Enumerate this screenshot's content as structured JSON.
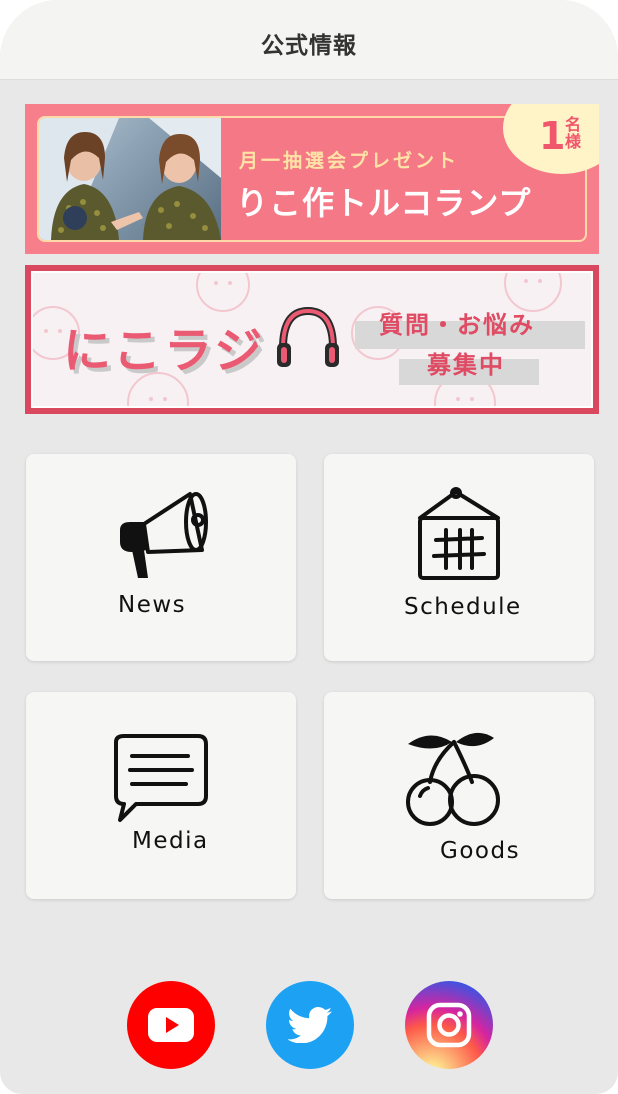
{
  "header": {
    "title": "公式情報"
  },
  "banner_present": {
    "subtitle": "月一抽選会プレゼント",
    "title": "りこ作トルコランプ",
    "badge_number": "1",
    "badge_unit": "名様"
  },
  "banner_radio": {
    "brand": "にこラジ",
    "message_line1": "質問・お悩み",
    "message_line2": "募集中"
  },
  "menu": {
    "news": "News",
    "schedule": "Schedule",
    "media": "Media",
    "goods": "Goods"
  },
  "social": {
    "youtube": "youtube-icon",
    "twitter": "twitter-icon",
    "instagram": "instagram-icon"
  },
  "colors": {
    "youtube": "#ff0000",
    "twitter": "#1da1f2",
    "banner_pink": "#f77f8c",
    "radio_red": "#d9485e"
  }
}
